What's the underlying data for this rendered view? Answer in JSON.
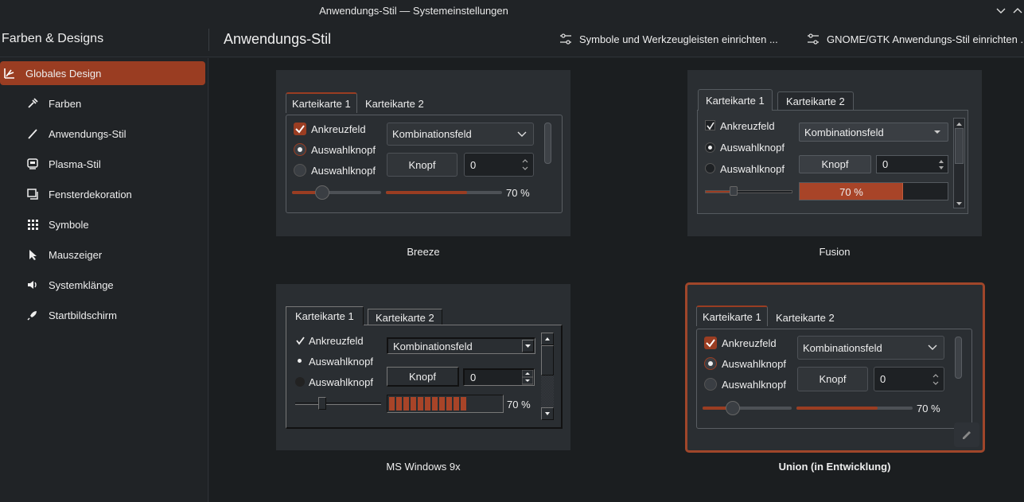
{
  "window": {
    "title": "Anwendungs-Stil — Systemeinstellungen"
  },
  "header": {
    "sidebar_title": "Farben & Designs",
    "page_title": "Anwendungs-Stil",
    "btn_icons": "Symbole und Werkzeugleisten einrichten ...",
    "btn_gtk": "GNOME/GTK Anwendungs-Stil einrichten ..."
  },
  "sidebar": {
    "items": [
      {
        "label": "Globales Design",
        "icon": "global-theme-icon"
      },
      {
        "label": "Farben",
        "icon": "color-picker-icon"
      },
      {
        "label": "Anwendungs-Stil",
        "icon": "brush-icon"
      },
      {
        "label": "Plasma-Stil",
        "icon": "plasma-icon"
      },
      {
        "label": "Fensterdekoration",
        "icon": "window-icon"
      },
      {
        "label": "Symbole",
        "icon": "grid-icon"
      },
      {
        "label": "Mauszeiger",
        "icon": "cursor-icon"
      },
      {
        "label": "Systemklänge",
        "icon": "speaker-icon"
      },
      {
        "label": "Startbildschirm",
        "icon": "rocket-icon"
      }
    ]
  },
  "widgets": {
    "tab1": "Karteikarte 1",
    "tab2": "Karteikarte 2",
    "checkbox": "Ankreuzfeld",
    "radio": "Auswahlknopf",
    "combo": "Kombinationsfeld",
    "button": "Knopf",
    "spin_value": "0",
    "progress_text": "70 %",
    "progress_value": 0.7
  },
  "styles": [
    {
      "name": "Breeze"
    },
    {
      "name": "Fusion"
    },
    {
      "name": "MS Windows 9x"
    },
    {
      "name": "Union (in Entwicklung)"
    }
  ],
  "colors": {
    "accent": "#9a3d22",
    "bg": "#1b1e20",
    "panel": "#2a2e32"
  }
}
